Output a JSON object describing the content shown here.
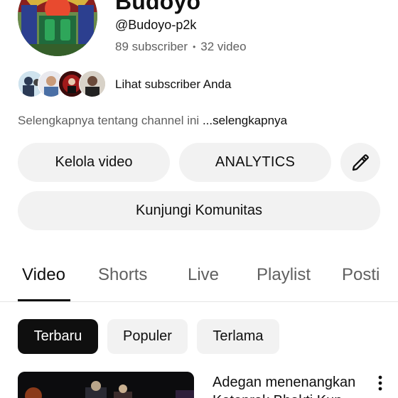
{
  "channel": {
    "name": "Budoyo",
    "handle": "@Budoyo-p2k",
    "subscribers": "89 subscriber",
    "separator": "•",
    "videos": "32 video",
    "view_subscribers": "Lihat subscriber Anda",
    "description": "Selengkapnya tentang channel ini",
    "more_link": "...selengkapnya"
  },
  "actions": {
    "manage_videos": "Kelola video",
    "analytics": "ANALYTICS",
    "edit_icon": "pencil-icon",
    "community": "Kunjungi Komunitas"
  },
  "tabs": [
    {
      "label": "Video",
      "active": true
    },
    {
      "label": "Shorts",
      "active": false
    },
    {
      "label": "Live",
      "active": false
    },
    {
      "label": "Playlist",
      "active": false
    },
    {
      "label": "Posti",
      "active": false
    }
  ],
  "filters": [
    {
      "label": "Terbaru",
      "active": true
    },
    {
      "label": "Populer",
      "active": false
    },
    {
      "label": "Terlama",
      "active": false
    }
  ],
  "videos": [
    {
      "title": "Adegan menenangkan Ketoprak Bhakti Kun"
    }
  ],
  "colors": {
    "text_primary": "#0f0f0f",
    "text_secondary": "#606060",
    "chip_bg": "#f2f2f2",
    "chip_active_bg": "#0f0f0f"
  }
}
